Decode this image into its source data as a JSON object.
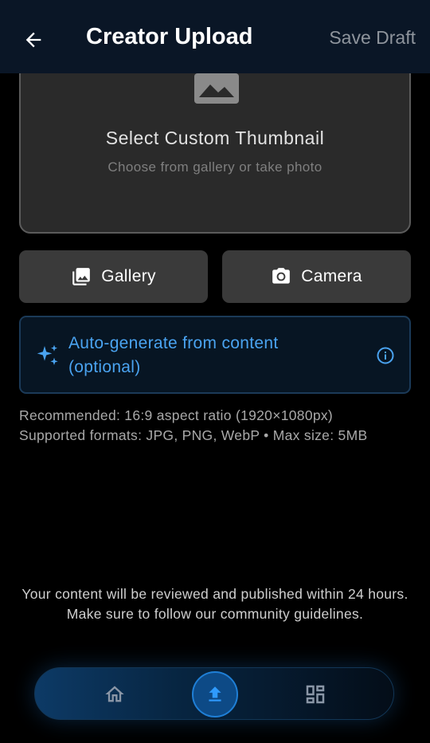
{
  "header": {
    "title": "Creator Upload",
    "save_draft": "Save Draft",
    "back_icon": "arrow-left-icon"
  },
  "thumbnail": {
    "title": "Select Custom Thumbnail",
    "subtitle": "Choose from gallery or take photo",
    "icon": "image-icon"
  },
  "actions": {
    "gallery_label": "Gallery",
    "gallery_icon": "photo-library-icon",
    "camera_label": "Camera",
    "camera_icon": "camera-icon"
  },
  "auto_generate": {
    "label": "Auto-generate from content (optional)",
    "icon": "sparkle-icon",
    "info_icon": "info-icon",
    "accent_color": "#4aa3f0"
  },
  "hints": {
    "recommended": "Recommended: 16:9 aspect ratio (1920×1080px)",
    "formats": "Supported formats: JPG, PNG, WebP • Max size: 5MB"
  },
  "review_note": "Your content will be reviewed and published within 24 hours. Make sure to follow our community guidelines.",
  "bottom_nav": {
    "items": [
      {
        "name": "home",
        "icon": "home-icon",
        "active": false
      },
      {
        "name": "upload",
        "icon": "upload-icon",
        "active": true
      },
      {
        "name": "dashboard",
        "icon": "dashboard-icon",
        "active": false
      }
    ]
  }
}
